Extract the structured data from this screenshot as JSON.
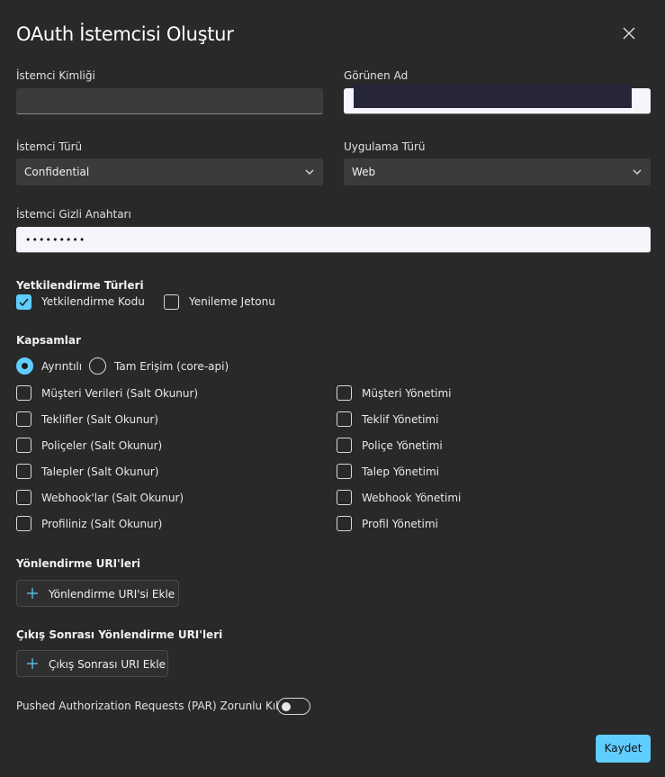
{
  "dialog": {
    "title": "OAuth İstemcisi Oluştur",
    "close_icon": "close-icon"
  },
  "fields": {
    "client_id": {
      "label": "İstemci Kimliği",
      "value": ""
    },
    "display_name": {
      "label": "Görünen Ad",
      "value": ""
    },
    "client_type": {
      "label": "İstemci Türü",
      "value": "Confidential"
    },
    "app_type": {
      "label": "Uygulama Türü",
      "value": "Web"
    },
    "client_secret": {
      "label": "İstemci Gizli Anahtarı",
      "value": "•••••••••"
    }
  },
  "grant_types": {
    "heading": "Yetkilendirme Türleri",
    "items": [
      {
        "label": "Yetkilendirme Kodu",
        "checked": true
      },
      {
        "label": "Yenileme Jetonu",
        "checked": false
      }
    ]
  },
  "scopes": {
    "heading": "Kapsamlar",
    "modes": [
      {
        "label": "Ayrıntılı",
        "selected": true
      },
      {
        "label": "Tam Erişim (core-api)",
        "selected": false
      }
    ],
    "left": [
      {
        "label": "Müşteri Verileri (Salt Okunur)",
        "checked": false
      },
      {
        "label": "Teklifler (Salt Okunur)",
        "checked": false
      },
      {
        "label": "Poliçeler (Salt Okunur)",
        "checked": false
      },
      {
        "label": "Talepler (Salt Okunur)",
        "checked": false
      },
      {
        "label": "Webhook'lar (Salt Okunur)",
        "checked": false
      },
      {
        "label": "Profiliniz (Salt Okunur)",
        "checked": false
      }
    ],
    "right": [
      {
        "label": "Müşteri Yönetimi",
        "checked": false
      },
      {
        "label": "Teklif Yönetimi",
        "checked": false
      },
      {
        "label": "Poliçe Yönetimi",
        "checked": false
      },
      {
        "label": "Talep Yönetimi",
        "checked": false
      },
      {
        "label": "Webhook Yönetimi",
        "checked": false
      },
      {
        "label": "Profil Yönetimi",
        "checked": false
      }
    ]
  },
  "redirect_uris": {
    "heading": "Yönlendirme URI'leri",
    "add_label": "Yönlendirme URI'si Ekle"
  },
  "post_logout_uris": {
    "heading": "Çıkış Sonrası Yönlendirme URI'leri",
    "add_label": "Çıkış Sonrası URI Ekle"
  },
  "par": {
    "label": "Pushed Authorization Requests (PAR) Zorunlu Kıl",
    "enabled": false
  },
  "footer": {
    "save_label": "Kaydet"
  },
  "colors": {
    "accent": "#60cdff",
    "background": "#292929"
  }
}
